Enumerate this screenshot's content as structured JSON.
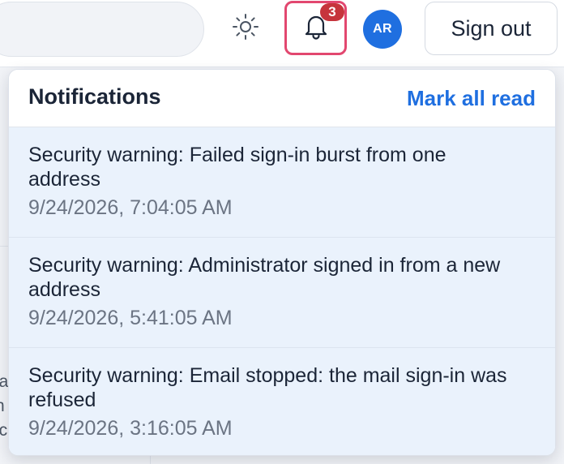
{
  "header": {
    "notifications_count": "3",
    "avatar_initials": "AR",
    "sign_out_label": "Sign out",
    "icons": {
      "theme": "sun-icon",
      "notifications": "bell-icon"
    }
  },
  "background": {
    "text_fragments": [
      "ia",
      "n",
      "ic"
    ]
  },
  "notifications_panel": {
    "title": "Notifications",
    "mark_all_read_label": "Mark all read",
    "items": [
      {
        "title": "Security warning: Failed sign-in burst from one address",
        "time": "9/24/2026, 7:04:05 AM"
      },
      {
        "title": "Security warning: Administrator signed in from a new address",
        "time": "9/24/2026, 5:41:05 AM"
      },
      {
        "title": "Security warning: Email stopped: the mail sign-in was refused",
        "time": "9/24/2026, 3:16:05 AM"
      }
    ]
  },
  "colors": {
    "accent": "#1f6fe0",
    "badge": "#c6343c",
    "bell_highlight": "#e2476f",
    "unread_background": "#eaf2fc"
  }
}
